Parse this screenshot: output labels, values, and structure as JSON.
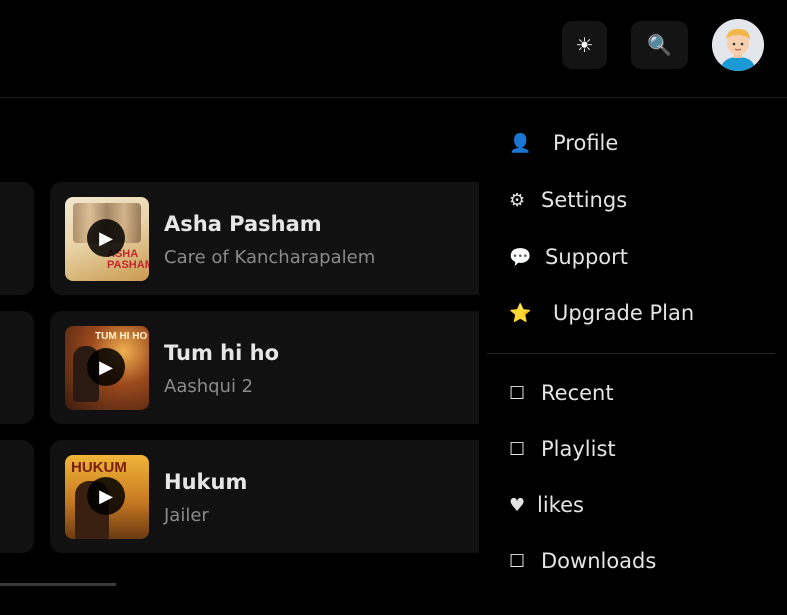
{
  "header": {
    "theme_icon": "☀",
    "search_icon": "🔍"
  },
  "songs": [
    {
      "title": "Asha Pasham",
      "subtitle": "Care of Kancharapalem",
      "thumb_text": "ASHA\nPASHAM"
    },
    {
      "title": "Tum hi ho",
      "subtitle": "Aashqui 2",
      "thumb_text": "TUM HI HO"
    },
    {
      "title": "Hukum",
      "subtitle": "Jailer",
      "thumb_text": "HUKUM"
    }
  ],
  "menu": {
    "top_items": [
      {
        "icon": "👤",
        "label": "Profile"
      },
      {
        "icon": "⚙",
        "label": "Settings"
      },
      {
        "icon": "💬",
        "label": "Support"
      },
      {
        "icon": "⭐",
        "label": "Upgrade Plan"
      }
    ],
    "bottom_items": [
      {
        "icon": "☐",
        "label": "Recent"
      },
      {
        "icon": "☐",
        "label": "Playlist"
      },
      {
        "icon": "♥",
        "label": "likes"
      },
      {
        "icon": "☐",
        "label": "Downloads"
      }
    ]
  },
  "colors": {
    "background": "#000000",
    "card": "#111111",
    "muted_text": "#8a8a8a"
  }
}
